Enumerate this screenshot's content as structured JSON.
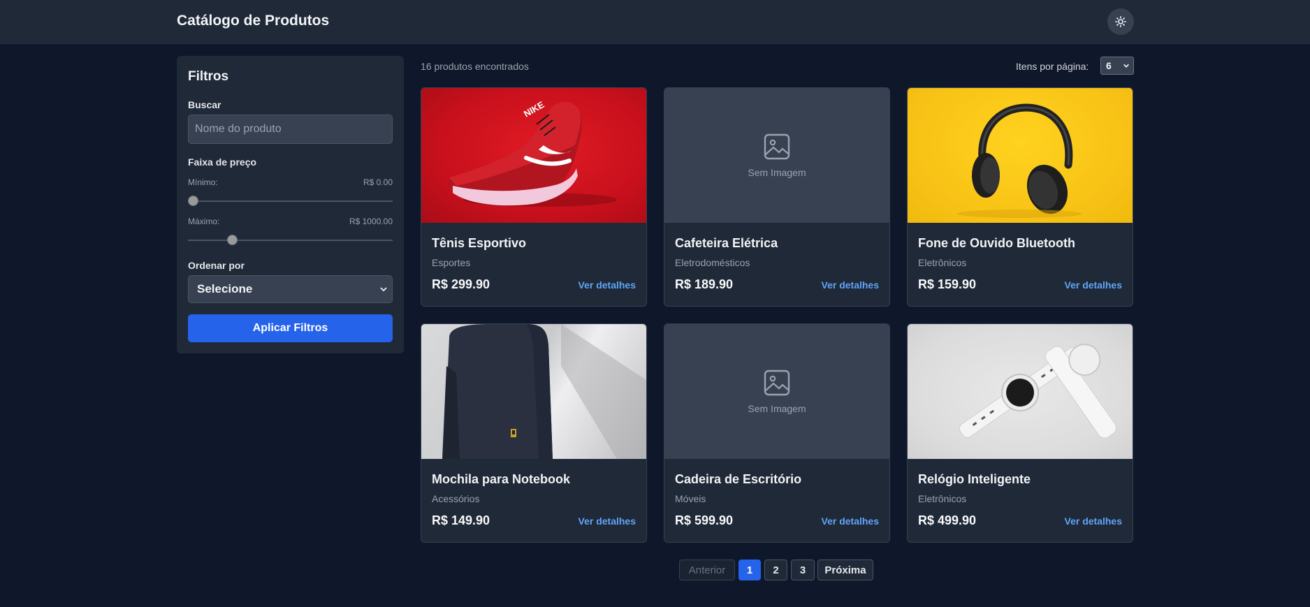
{
  "header": {
    "title": "Catálogo de Produtos",
    "theme_icon": "sun-icon"
  },
  "filters": {
    "title": "Filtros",
    "search": {
      "label": "Buscar",
      "placeholder": "Nome do produto",
      "value": ""
    },
    "price_range": {
      "label": "Faixa de preço",
      "min_label": "Mínimo:",
      "min_value_text": "R$ 0.00",
      "min_level": 0.0,
      "max_label": "Máximo:",
      "max_value_text": "R$ 1000.00",
      "max_level": 0.2
    },
    "sort": {
      "label": "Ordenar por",
      "selected": "Selecione"
    },
    "apply_label": "Aplicar Filtros"
  },
  "results": {
    "count_text": "16 produtos encontrados",
    "per_page_label": "Itens por página:",
    "per_page_value": "6"
  },
  "products": [
    {
      "name": "Tênis Esportivo",
      "category": "Esportes",
      "price": "R$ 299.90",
      "details": "Ver detalhes",
      "image": "sneaker"
    },
    {
      "name": "Cafeteira Elétrica",
      "category": "Eletrodomésticos",
      "price": "R$ 189.90",
      "details": "Ver detalhes",
      "image": "none",
      "no_image_text": "Sem Imagem"
    },
    {
      "name": "Fone de Ouvido Bluetooth",
      "category": "Eletrônicos",
      "price": "R$ 159.90",
      "details": "Ver detalhes",
      "image": "headphones"
    },
    {
      "name": "Mochila para Notebook",
      "category": "Acessórios",
      "price": "R$ 149.90",
      "details": "Ver detalhes",
      "image": "backpack"
    },
    {
      "name": "Cadeira de Escritório",
      "category": "Móveis",
      "price": "R$ 599.90",
      "details": "Ver detalhes",
      "image": "none",
      "no_image_text": "Sem Imagem"
    },
    {
      "name": "Relógio Inteligente",
      "category": "Eletrônicos",
      "price": "R$ 499.90",
      "details": "Ver detalhes",
      "image": "watch"
    }
  ],
  "pagination": {
    "prev": "Anterior",
    "pages": [
      "1",
      "2",
      "3"
    ],
    "current": "1",
    "next": "Próxima"
  },
  "colors": {
    "accent": "#2563eb",
    "link": "#60a5fa",
    "background": "#0f172a",
    "surface": "#1f2937"
  }
}
